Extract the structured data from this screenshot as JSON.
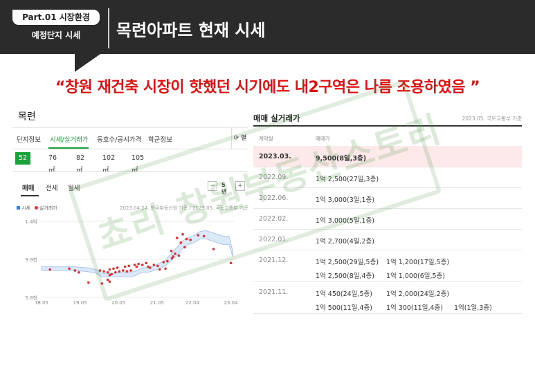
{
  "header": {
    "badge": "Part.01 시장환경",
    "badge_sub": "예정단지 시세",
    "title": "목련아파트 현재 시세"
  },
  "quote": "“창원 재건축 시장이 핫했던 시기에도 내2구역은 나름 조용하였음 ”",
  "left_panel": {
    "complex_name": "목련",
    "tabs": [
      "단지정보",
      "시세/실거래가",
      "동호수/공시가격",
      "학군정보"
    ],
    "refresh_label": "⟳ 펼",
    "sizes": [
      "52㎡",
      "76㎡",
      "82㎡",
      "102㎡",
      "105㎡"
    ],
    "chart_tabs": [
      "매매",
      "전세",
      "월세"
    ],
    "period_minus": "−",
    "period_value": "5년",
    "period_plus": "+",
    "legend_price": "시세",
    "legend_actual": "실거래가",
    "source_note": "2023.04.24. 한국부동산원 기준 / 2023.05. 국토교통부 기준"
  },
  "chart_data": {
    "type": "scatter",
    "y_tick_labels": [
      "1.4억",
      "9.9천",
      "5.8천"
    ],
    "x_tick_labels": [
      "18.05",
      "19.05",
      "20.05",
      "21.05",
      "22.04",
      "23.04"
    ],
    "ylim": [
      5800,
      14000
    ],
    "xlim": [
      2018.33,
      2023.33
    ],
    "series": [
      {
        "name": "시세",
        "type": "area",
        "x": [
          2018.33,
          2018.6,
          2018.9,
          2019.2,
          2019.5,
          2019.75,
          2019.9,
          2020.05,
          2020.2,
          2020.35,
          2020.5,
          2020.65,
          2020.8,
          2020.95,
          2021.1,
          2021.25,
          2021.4,
          2021.55,
          2021.7,
          2021.85,
          2022.0,
          2022.15,
          2022.3,
          2022.45,
          2022.6,
          2022.75,
          2022.9,
          2023.05,
          2023.2,
          2023.3
        ],
        "lower": [
          8700,
          8700,
          8700,
          8700,
          8600,
          8400,
          8000,
          8000,
          8000,
          8000,
          8000,
          8000,
          8200,
          8500,
          8500,
          8700,
          8900,
          9200,
          9800,
          10300,
          11100,
          11500,
          11700,
          12100,
          12100,
          11900,
          11700,
          11500,
          11500,
          10200
        ],
        "upper": [
          9100,
          9100,
          9100,
          9100,
          9000,
          8800,
          8400,
          8400,
          8400,
          8500,
          8500,
          8500,
          8700,
          9000,
          9000,
          9200,
          9500,
          9800,
          10500,
          11200,
          11900,
          12300,
          12500,
          12900,
          13000,
          12800,
          12600,
          12400,
          12400,
          10800
        ]
      },
      {
        "name": "실거래가",
        "type": "scatter",
        "points": [
          [
            2018.55,
            8800
          ],
          [
            2019.05,
            8900
          ],
          [
            2019.2,
            8700
          ],
          [
            2019.3,
            8500
          ],
          [
            2019.55,
            7400
          ],
          [
            2019.85,
            8700
          ],
          [
            2019.9,
            7300
          ],
          [
            2019.95,
            8600
          ],
          [
            2020.05,
            8500
          ],
          [
            2020.05,
            7700
          ],
          [
            2020.1,
            7500
          ],
          [
            2020.1,
            8800
          ],
          [
            2020.1,
            8200
          ],
          [
            2020.15,
            8300
          ],
          [
            2020.2,
            8900
          ],
          [
            2020.25,
            8500
          ],
          [
            2020.3,
            9000
          ],
          [
            2020.35,
            8600
          ],
          [
            2020.45,
            8700
          ],
          [
            2020.5,
            9100
          ],
          [
            2020.55,
            8600
          ],
          [
            2020.6,
            9200
          ],
          [
            2020.65,
            8700
          ],
          [
            2020.75,
            9300
          ],
          [
            2020.8,
            9100
          ],
          [
            2020.85,
            9400
          ],
          [
            2020.95,
            9300
          ],
          [
            2021.05,
            9500
          ],
          [
            2021.1,
            9100
          ],
          [
            2021.15,
            9000
          ],
          [
            2021.25,
            9300
          ],
          [
            2021.35,
            9200
          ],
          [
            2021.4,
            8800
          ],
          [
            2021.5,
            9600
          ],
          [
            2021.55,
            8900
          ],
          [
            2021.6,
            9700
          ],
          [
            2021.7,
            10800
          ],
          [
            2021.72,
            10000
          ],
          [
            2021.75,
            10200
          ],
          [
            2021.8,
            10500
          ],
          [
            2021.85,
            12200
          ],
          [
            2021.9,
            10300
          ],
          [
            2021.95,
            11700
          ],
          [
            2022.0,
            12600
          ],
          [
            2022.05,
            11200
          ],
          [
            2022.1,
            12100
          ],
          [
            2022.2,
            12000
          ],
          [
            2022.4,
            12500
          ],
          [
            2022.55,
            12400
          ],
          [
            2022.8,
            11000
          ],
          [
            2023.25,
            9500
          ]
        ]
      }
    ]
  },
  "right_panel": {
    "title": "매매 실거래가",
    "source": "2023.05. 국토교통부 기준",
    "col_date": "계약월",
    "col_price": "매매가",
    "rows": [
      {
        "date": "2023.03.",
        "l1": [
          "9,500(8일,3층)"
        ],
        "l2": []
      },
      {
        "date": "2022.09.",
        "l1": [
          "1억 2,500(27일,3층)"
        ],
        "l2": []
      },
      {
        "date": "2022.06.",
        "l1": [
          "1억 3,000(3일,1층)"
        ],
        "l2": []
      },
      {
        "date": "2022.02.",
        "l1": [
          "1억 3,000(5일,1층)"
        ],
        "l2": []
      },
      {
        "date": "2022.01.",
        "l1": [
          "1억 2,700(4일,2층)"
        ],
        "l2": []
      },
      {
        "date": "2021.12.",
        "l1": [
          "1억 2,500(29일,5층)",
          "1억 1,200(17일,5층)"
        ],
        "l2": [
          "1억 2,500(8일,4층)",
          "1억 1,000(6일,5층)"
        ]
      },
      {
        "date": "2021.11.",
        "l1": [
          "1억 450(24일,5층)",
          "1억 2,000(24일,2층)"
        ],
        "l2": [
          "1억 500(11일,4층)",
          "1억 300(11일,4층)",
          "1억(1일,3층)"
        ]
      }
    ]
  },
  "watermark": "쵸리 창원부동산스토리",
  "colors": {
    "header_bg": "#2b2b2b",
    "accent_green": "#1aa33a",
    "quote_red": "#e01010",
    "scatter_red": "#e03030",
    "band_blue": "#3a7fd8",
    "highlight_pink": "#fde9ea"
  }
}
